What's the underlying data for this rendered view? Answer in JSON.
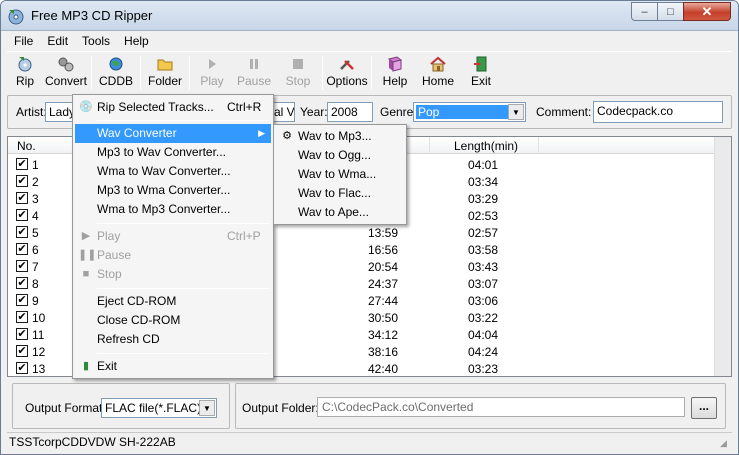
{
  "window": {
    "title": "Free MP3 CD Ripper",
    "minimize_glyph": "–",
    "maximize_glyph": "□",
    "close_glyph": "✕"
  },
  "menubar": [
    "File",
    "Edit",
    "Tools",
    "Help"
  ],
  "toolbar": {
    "rip": "Rip",
    "convert": "Convert",
    "cddb": "CDDB",
    "folder": "Folder",
    "play": "Play",
    "pause": "Pause",
    "stop": "Stop",
    "options": "Options",
    "help": "Help",
    "home": "Home",
    "exit": "Exit"
  },
  "info": {
    "artist_label": "Artist:",
    "artist_value": "Lady",
    "album_tail": "al V",
    "year_label": "Year:",
    "year_value": "2008",
    "genre_label": "Genre:",
    "genre_value": "Pop",
    "comment_label": "Comment:",
    "comment_value": "Codecpack.co"
  },
  "list": {
    "columns": {
      "no": "No.",
      "length": "Length(min)"
    },
    "rows": [
      {
        "no": "1",
        "start": "",
        "length": "04:01"
      },
      {
        "no": "2",
        "start": "",
        "length": "03:34"
      },
      {
        "no": "3",
        "start": "",
        "length": "03:29"
      },
      {
        "no": "4",
        "start": "",
        "length": "02:53"
      },
      {
        "no": "5",
        "start": "13:59",
        "length": "02:57"
      },
      {
        "no": "6",
        "start": "16:56",
        "length": "03:58"
      },
      {
        "no": "7",
        "start": "20:54",
        "length": "03:43"
      },
      {
        "no": "8",
        "start": "24:37",
        "length": "03:07"
      },
      {
        "no": "9",
        "start": "27:44",
        "length": "03:06"
      },
      {
        "no": "10",
        "start": "30:50",
        "length": "03:22"
      },
      {
        "no": "11",
        "start": "34:12",
        "length": "04:04"
      },
      {
        "no": "12",
        "start": "38:16",
        "length": "04:24"
      },
      {
        "no": "13",
        "start": "42:40",
        "length": "03:23"
      }
    ],
    "check_glyph": "✔"
  },
  "output": {
    "format_label": "Output Format:",
    "format_value": "FLAC file(*.FLAC)",
    "folder_label": "Output Folder:",
    "folder_value": "C:\\CodecPack.co\\Converted",
    "browse_label": "..."
  },
  "status": {
    "drive": "TSSTcorpCDDVDW SH-222AB"
  },
  "tools_menu": {
    "rip_selected": "Rip Selected Tracks...",
    "rip_shortcut": "Ctrl+R",
    "wav_converter": "Wav Converter",
    "mp3_to_wav": "Mp3 to Wav Converter...",
    "wma_to_wav": "Wma to Wav Converter...",
    "mp3_to_wma": "Mp3 to Wma Converter...",
    "wma_to_mp3": "Wma to Mp3 Converter...",
    "play": "Play",
    "play_shortcut": "Ctrl+P",
    "pause": "Pause",
    "stop": "Stop",
    "eject": "Eject CD-ROM",
    "close": "Close CD-ROM",
    "refresh": "Refresh CD",
    "exit": "Exit"
  },
  "wav_submenu": {
    "to_mp3": "Wav to Mp3...",
    "to_ogg": "Wav to Ogg...",
    "to_wma": "Wav to Wma...",
    "to_flac": "Wav to Flac...",
    "to_ape": "Wav to Ape..."
  },
  "colors": {
    "highlight": "#3399ff",
    "accent_disabled": "#a0a0a0"
  }
}
